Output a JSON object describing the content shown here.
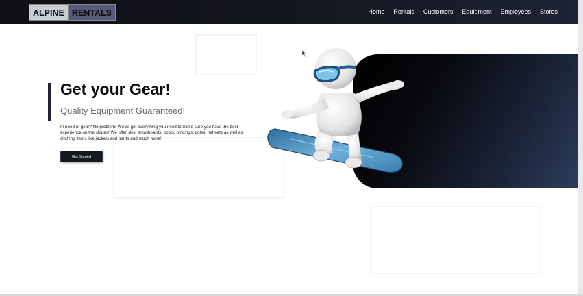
{
  "brand": {
    "left": "ALPINE",
    "right": "RENTALS"
  },
  "nav": {
    "items": [
      "Home",
      "Rentals",
      "Customers",
      "Equipment",
      "Employees",
      "Stores"
    ]
  },
  "hero": {
    "title": "Get your Gear!",
    "subtitle": "Quality Equipment Guaranteed!",
    "body": "In need of gear? No problem! We've got everything you need to make sure you have the best experience on the slopes! We offer skis, snowboards, boots, bindings, poles, helmets as well as clothing items like jackets and pants and much more!",
    "cta_label": "Get Started"
  },
  "colors": {
    "nav_bg": "#14161f",
    "panel_dark": "#000000",
    "panel_light": "#2d3d5c",
    "accent_bar": "#222737",
    "board": "#5b9ec9"
  },
  "icons": {
    "mascot": "snowboarder-illustration",
    "cursor": "mouse-pointer-icon"
  }
}
